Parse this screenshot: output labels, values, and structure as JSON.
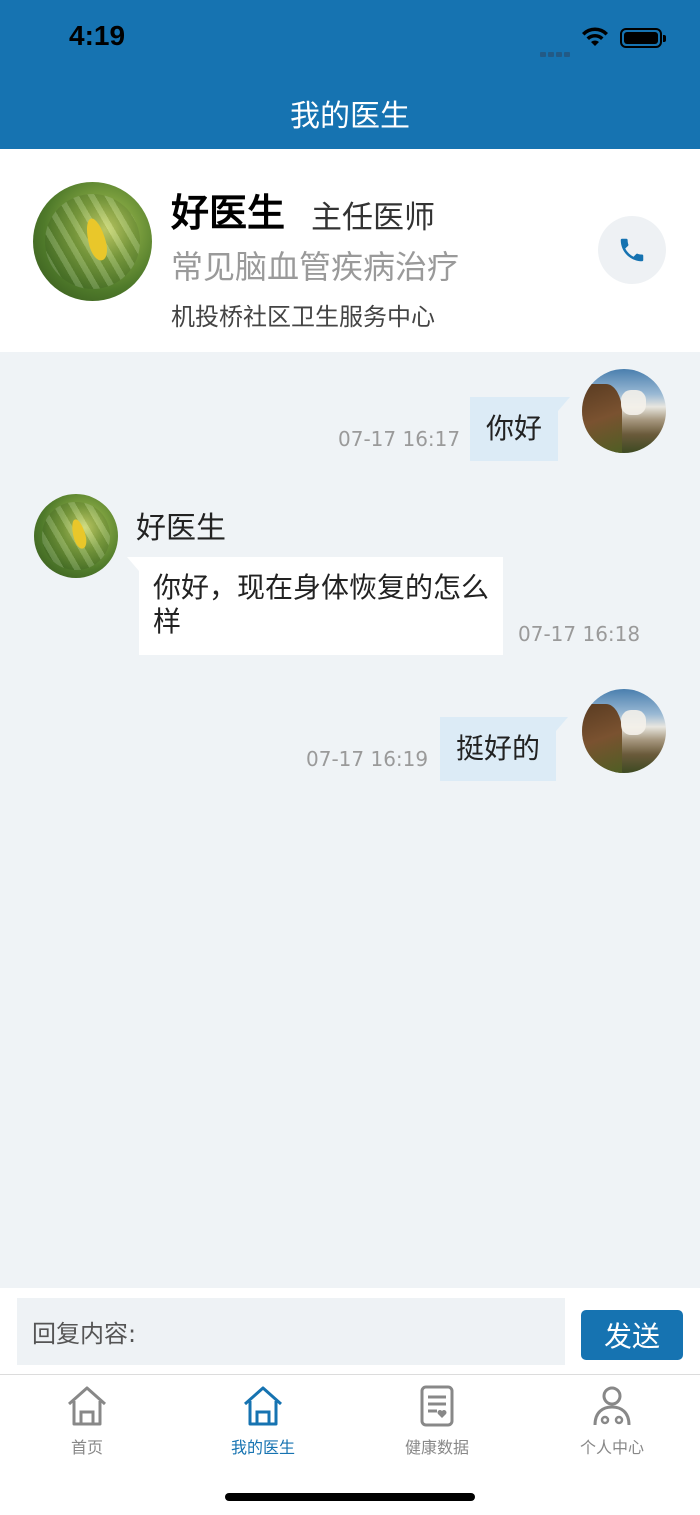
{
  "status_bar": {
    "time": "4:19"
  },
  "header": {
    "title": "我的医生"
  },
  "doctor": {
    "name": "好医生",
    "title": "主任医师",
    "specialty": "常见脑血管疾病治疗",
    "organization": "机投桥社区卫生服务中心",
    "call_icon": "phone-icon"
  },
  "messages": [
    {
      "direction": "outgoing",
      "text": "你好",
      "time": "07-17 16:17"
    },
    {
      "direction": "incoming",
      "sender": "好医生",
      "text": "你好，现在身体恢复的怎么样",
      "time": "07-17 16:18"
    },
    {
      "direction": "outgoing",
      "text": "挺好的",
      "time": "07-17 16:19"
    }
  ],
  "input": {
    "placeholder": "回复内容:",
    "send_label": "发送"
  },
  "tabs": [
    {
      "label": "首页",
      "icon": "home-icon",
      "active": false
    },
    {
      "label": "我的医生",
      "icon": "doctor-home-icon",
      "active": true
    },
    {
      "label": "健康数据",
      "icon": "health-record-icon",
      "active": false
    },
    {
      "label": "个人中心",
      "icon": "user-icon",
      "active": false
    }
  ],
  "colors": {
    "primary": "#1673b1",
    "chat_bg": "#eff3f6",
    "bubble_out": "#dcebf6",
    "bubble_in": "#ffffff"
  }
}
